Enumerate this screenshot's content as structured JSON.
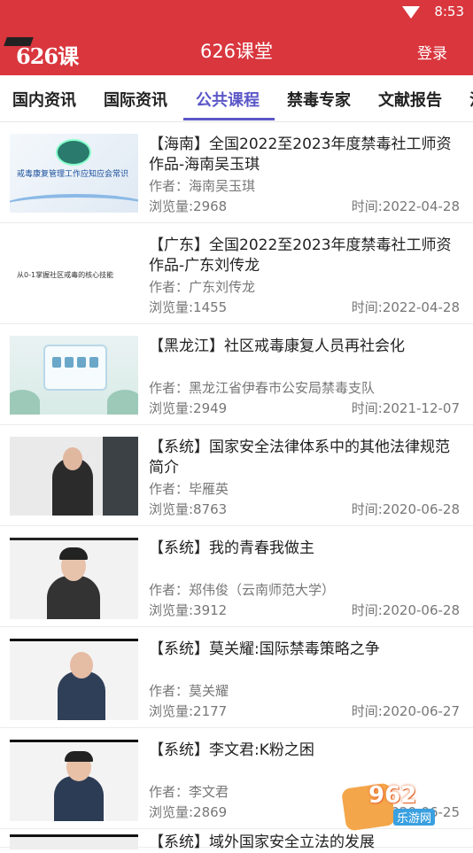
{
  "status_bar": {
    "time": "8:53"
  },
  "app_bar": {
    "logo_text": "626课堂",
    "title": "626课堂",
    "login_label": "登录"
  },
  "tabs": [
    {
      "label": "国内资讯"
    },
    {
      "label": "国际资讯"
    },
    {
      "label": "公共课程",
      "active": true
    },
    {
      "label": "禁毒专家"
    },
    {
      "label": "文献报告"
    },
    {
      "label": "法"
    }
  ],
  "thumb_text": {
    "item1": "戒毒康复管理工作应知应会常识",
    "item2": "从0-1掌握社区戒毒的核心技能"
  },
  "items": [
    {
      "title": "【海南】全国2022至2023年度禁毒社工师资作品-海南吴玉琪",
      "author": "作者：海南吴玉琪",
      "views": "浏览量:2968",
      "time": "时间:2022-04-28"
    },
    {
      "title": "【广东】全国2022至2023年度禁毒社工师资作品-广东刘传龙",
      "author": "作者：广东刘传龙",
      "views": "浏览量:1455",
      "time": "时间:2022-04-28"
    },
    {
      "title": "【黑龙江】社区戒毒康复人员再社会化",
      "author": "作者：黑龙江省伊春市公安局禁毒支队",
      "views": "浏览量:2949",
      "time": "时间:2021-12-07"
    },
    {
      "title": "【系统】国家安全法律体系中的其他法律规范简介",
      "author": "作者：毕雁英",
      "views": "浏览量:8763",
      "time": "时间:2020-06-28"
    },
    {
      "title": "【系统】我的青春我做主",
      "author": "作者：郑伟俊（云南师范大学）",
      "views": "浏览量:3912",
      "time": "时间:2020-06-28"
    },
    {
      "title": "【系统】莫关耀:国际禁毒策略之争",
      "author": "作者：莫关耀",
      "views": "浏览量:2177",
      "time": "时间:2020-06-27"
    },
    {
      "title": "【系统】李文君:K粉之困",
      "author": "作者：李文君",
      "views": "浏览量:2869",
      "time": "时间:2020-06-25"
    },
    {
      "title": "【系统】域外国家安全立法的发展"
    }
  ],
  "watermark": {
    "main": "962",
    "sub": "乐游网"
  }
}
